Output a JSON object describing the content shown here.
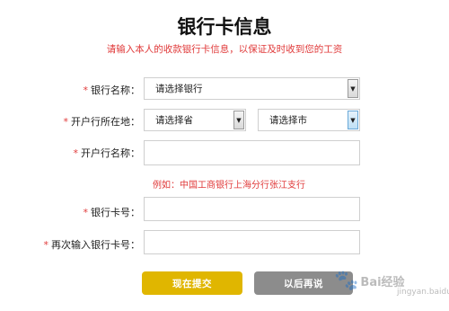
{
  "page": {
    "title": "银行卡信息",
    "subtitle": "请输入本人的收款银行卡信息，以保证及时收到您的工资"
  },
  "form": {
    "required_mark": "*",
    "bank_name": {
      "label": "银行名称：",
      "value": "请选择银行"
    },
    "branch_location": {
      "label": "开户行所在地：",
      "province_value": "请选择省",
      "city_value": "请选择市"
    },
    "branch_name": {
      "label": "开户行名称：",
      "value": ""
    },
    "example": "例如：中国工商银行上海分行张江支行",
    "card_number": {
      "label": "银行卡号：",
      "value": ""
    },
    "card_number_confirm": {
      "label": "再次输入银行卡号：",
      "value": ""
    }
  },
  "actions": {
    "submit_label": "现在提交",
    "later_label": "以后再说"
  },
  "watermark": {
    "text": "Bai经验",
    "sub": "jingyan.baidu.com"
  },
  "colors": {
    "accent_red": "#e03a3a",
    "submit_yellow": "#e0b600",
    "later_gray": "#8c8c8c"
  }
}
